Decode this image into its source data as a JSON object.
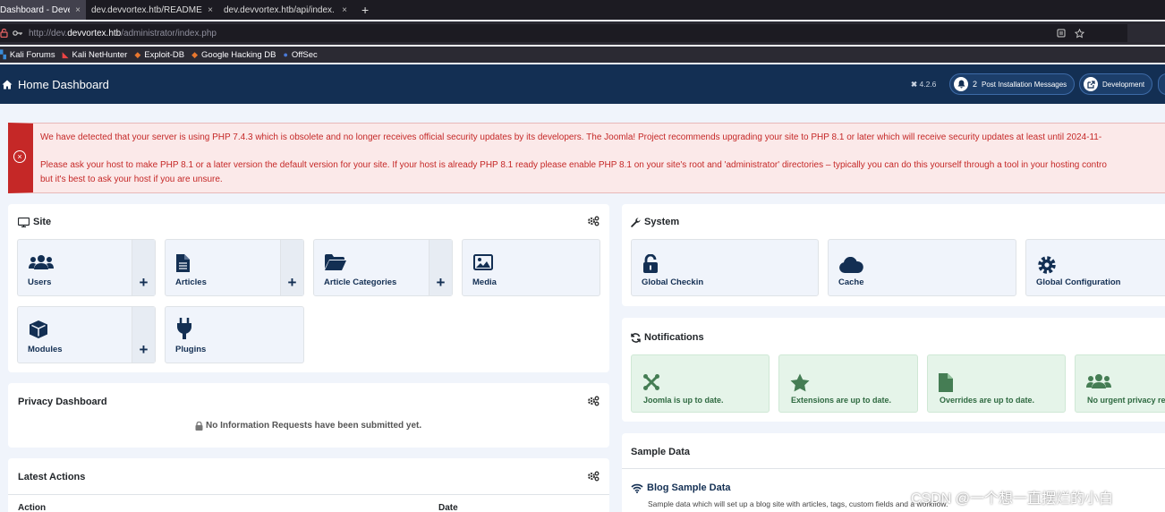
{
  "browser": {
    "tabs": [
      {
        "label": "Dashboard - Deve",
        "active": true
      },
      {
        "label": "dev.devvortex.htb/README.",
        "active": false
      },
      {
        "label": "dev.devvortex.htb/api/index.",
        "active": false
      }
    ],
    "close_glyph": "×",
    "new_tab_glyph": "+",
    "url_prefix": "http://dev.",
    "url_domain": "devvortex.htb",
    "url_path": "/administrator/index.php",
    "bookmarks": [
      "Kali Forums",
      "Kali NetHunter",
      "Exploit-DB",
      "Google Hacking DB",
      "OffSec"
    ]
  },
  "header": {
    "title": "Home Dashboard",
    "version": "4.2.6",
    "notification_count": "2",
    "post_install_label": "Post Installation Messages",
    "development_label": "Development"
  },
  "alert": {
    "line1": "We have detected that your server is using PHP 7.4.3 which is obsolete and no longer receives official security updates by its developers. The Joomla! Project recommends upgrading your site to PHP 8.1 or later which will receive security updates at least until 2024-11-",
    "line2": "Please ask your host to make PHP 8.1 or a later version the default version for your site. If your host is already PHP 8.1 ready please enable PHP 8.1 on your site's root and 'administrator' directories – typically you can do this yourself through a tool in your hosting contro",
    "line3": "but it's best to ask your host if you are unsure."
  },
  "site_panel": {
    "title": "Site",
    "tiles": [
      {
        "label": "Users",
        "icon": "users-icon"
      },
      {
        "label": "Articles",
        "icon": "article-icon"
      },
      {
        "label": "Article Categories",
        "icon": "folder-icon"
      },
      {
        "label": "Media",
        "icon": "image-icon"
      },
      {
        "label": "Modules",
        "icon": "cube-icon"
      },
      {
        "label": "Plugins",
        "icon": "plug-icon"
      }
    ],
    "plus_glyph": "+"
  },
  "privacy_panel": {
    "title": "Privacy Dashboard",
    "message": "No Information Requests have been submitted yet."
  },
  "latest_actions": {
    "title": "Latest Actions",
    "col_action": "Action",
    "col_date": "Date"
  },
  "system_panel": {
    "title": "System",
    "tiles": [
      {
        "label": "Global Checkin",
        "icon": "lock-icon"
      },
      {
        "label": "Cache",
        "icon": "cloud-icon"
      },
      {
        "label": "Global Configuration",
        "icon": "gear-icon"
      }
    ]
  },
  "notifications_panel": {
    "title": "Notifications",
    "tiles": [
      {
        "label": "Joomla is up to date.",
        "icon": "joomla-icon"
      },
      {
        "label": "Extensions are up to date.",
        "icon": "star-icon"
      },
      {
        "label": "Overrides are up to date.",
        "icon": "file-icon"
      },
      {
        "label": "No urgent privacy rec",
        "icon": "users-icon"
      }
    ]
  },
  "sample_data": {
    "title": "Sample Data",
    "blog_title": "Blog Sample Data",
    "blog_desc": "Sample data which will set up a blog site with articles, tags, custom fields and a workflow."
  },
  "watermark": "CSDN @一个想一直摆烂的小白",
  "colors": {
    "header": "#132f53",
    "alert": "#c52827",
    "tile_text": "#132f53",
    "success": "#457d54"
  }
}
